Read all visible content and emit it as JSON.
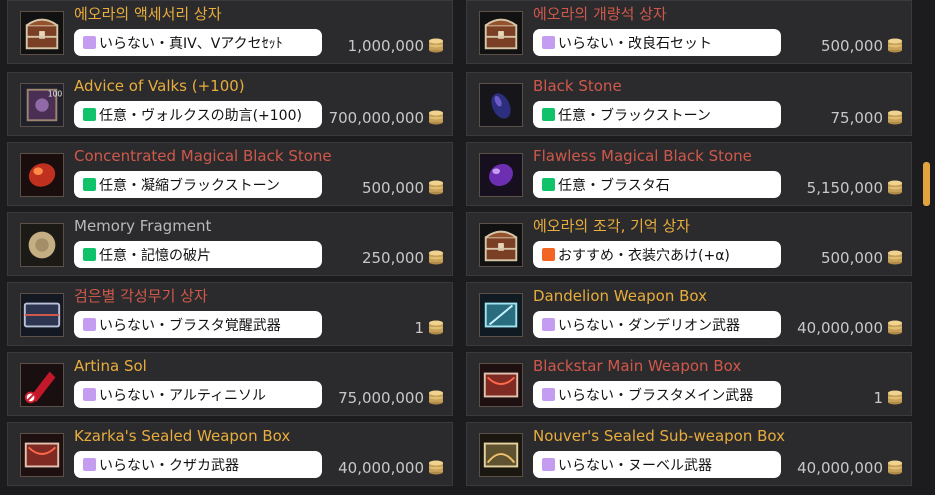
{
  "currency_icon": "silver-coin-icon",
  "colors": {
    "gold": "#e8ad3c",
    "red": "#d0584a",
    "gray": "#b9b9b9",
    "purple": "#c59df0",
    "green": "#10c36b",
    "orange": "#f26522"
  },
  "items": [
    {
      "name": "에오라의 액세서리 상자",
      "name_color": "gold",
      "tag": "いらない・真IV、Vアクセｾｯﾄ",
      "tag_color": "purple",
      "price": "1,000,000",
      "icon": "treasure-chest-icon"
    },
    {
      "name": "에오라의 개량석 상자",
      "name_color": "red",
      "tag": "いらない・改良石セット",
      "tag_color": "purple",
      "price": "500,000",
      "icon": "treasure-chest-icon"
    },
    {
      "name": "Advice of Valks (+100)",
      "name_color": "gold",
      "tag": "任意・ヴォルクスの助言(+100)",
      "tag_color": "green",
      "price": "700,000,000",
      "icon": "scroll-book-icon"
    },
    {
      "name": "Black Stone",
      "name_color": "red",
      "tag": "任意・ブラックストーン",
      "tag_color": "green",
      "price": "75,000",
      "icon": "black-stone-icon"
    },
    {
      "name": "Concentrated Magical Black Stone",
      "name_color": "red",
      "tag": "任意・凝縮ブラックストーン",
      "tag_color": "green",
      "price": "500,000",
      "icon": "red-stone-icon"
    },
    {
      "name": "Flawless Magical Black Stone",
      "name_color": "red",
      "tag": "任意・ブラスタ石",
      "tag_color": "green",
      "price": "5,150,000",
      "icon": "purple-gem-icon"
    },
    {
      "name": "Memory Fragment",
      "name_color": "gray",
      "tag": "任意・記憶の破片",
      "tag_color": "green",
      "price": "250,000",
      "icon": "memory-fragment-icon"
    },
    {
      "name": "에오라의 조각, 기억 상자",
      "name_color": "gold",
      "tag": "おすすめ・衣装穴あけ(+α)",
      "tag_color": "orange",
      "price": "500,000",
      "icon": "treasure-chest-icon"
    },
    {
      "name": "검은별 각성무기 상자",
      "name_color": "red",
      "tag": "いらない・ブラスタ覚醒武器",
      "tag_color": "purple",
      "price": "1",
      "icon": "weapon-case-icon"
    },
    {
      "name": "Dandelion Weapon Box",
      "name_color": "gold",
      "tag": "いらない・ダンデリオン武器",
      "tag_color": "purple",
      "price": "40,000,000",
      "icon": "cyan-weapon-box-icon"
    },
    {
      "name": "Artina Sol",
      "name_color": "gold",
      "tag": "いらない・アルティニソル",
      "tag_color": "purple",
      "price": "75,000,000",
      "icon": "red-crystal-icon"
    },
    {
      "name": "Blackstar Main Weapon Box",
      "name_color": "red",
      "tag": "いらない・ブラスタメイン武器",
      "tag_color": "purple",
      "price": "1",
      "icon": "red-weapon-box-icon"
    },
    {
      "name": "Kzarka's Sealed Weapon Box",
      "name_color": "gold",
      "tag": "いらない・クザカ武器",
      "tag_color": "purple",
      "price": "40,000,000",
      "icon": "red-weapon-box-icon"
    },
    {
      "name": "Nouver's Sealed Sub-weapon Box",
      "name_color": "gold",
      "tag": "いらない・ヌーベル武器",
      "tag_color": "purple",
      "price": "40,000,000",
      "icon": "gold-weapon-box-icon"
    }
  ]
}
